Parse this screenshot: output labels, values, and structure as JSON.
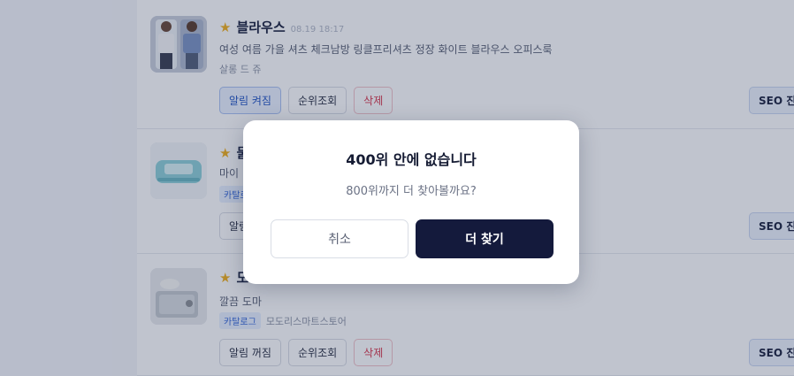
{
  "products": [
    {
      "title": "블라우스",
      "date": "08.19 18:17",
      "description": "여성 여름 가을 셔츠 체크남방 링클프리셔츠 정장 화이트 블라우스 오피스룩",
      "tag": "",
      "store": "살롱 드 쥬",
      "alert_label": "알림 켜짐",
      "alert_on": true,
      "rank_label": "순위조회",
      "delete_label": "삭제",
      "seo_label": "SEO 진단"
    },
    {
      "title": "물티슈",
      "date": "",
      "description": "마이",
      "tag": "카탈로그",
      "store": "",
      "alert_label": "알림",
      "alert_on": false,
      "rank_label": "",
      "delete_label": "",
      "seo_label": "SEO 진단"
    },
    {
      "title": "도마",
      "date": "",
      "description": "깔끔 도마",
      "tag": "카탈로그",
      "store": "모도리스마트스토어",
      "alert_label": "알림 꺼짐",
      "alert_on": false,
      "rank_label": "순위조회",
      "delete_label": "삭제",
      "seo_label": "SEO 진단"
    }
  ],
  "star_icon": "star-icon",
  "modal": {
    "title": "400위 안에 없습니다",
    "message": "800위까지 더 찾아볼까요?",
    "cancel_label": "취소",
    "confirm_label": "더 찾기"
  },
  "colors": {
    "accent_dark": "#141a3c",
    "star": "#f2b01e",
    "delete": "#d8394f",
    "alert_on": "#2456c4"
  }
}
